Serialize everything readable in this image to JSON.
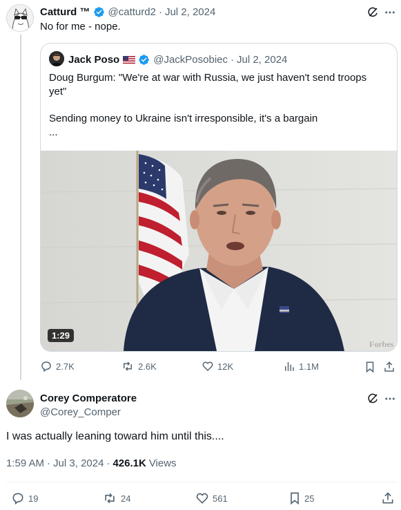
{
  "post1": {
    "author_name": "Catturd ™",
    "handle": "@catturd2",
    "separator": "·",
    "date": "Jul 2, 2024",
    "text": "No for me - nope."
  },
  "quote": {
    "author_name": "Jack Poso",
    "handle": "@JackPosobiec",
    "separator": "·",
    "date": "Jul 2, 2024",
    "text_line1": "Doug Burgum: \"We're at war with Russia, we just haven't send troops",
    "text_line2": "yet\"",
    "text_line3": "Sending money to Ukraine isn't irresponsible, it's a bargain",
    "text_line4": "...",
    "video_duration": "1:29",
    "watermark": "Forbes"
  },
  "post1_actions": {
    "replies": "2.7K",
    "reposts": "2.6K",
    "likes": "12K",
    "views": "1.1M"
  },
  "post2": {
    "author_name": "Corey Comperatore",
    "handle": "@Corey_Comper",
    "text": "I was actually leaning toward him until this....",
    "time": "1:59 AM",
    "separator": "·",
    "date": "Jul 3, 2024",
    "views_count": "426.1K",
    "views_label": "Views"
  },
  "post2_actions": {
    "replies": "19",
    "reposts": "24",
    "likes": "561",
    "bookmarks": "25"
  },
  "colors": {
    "verified": "#1d9bf0",
    "muted": "#536471",
    "border": "#cfd9de"
  }
}
